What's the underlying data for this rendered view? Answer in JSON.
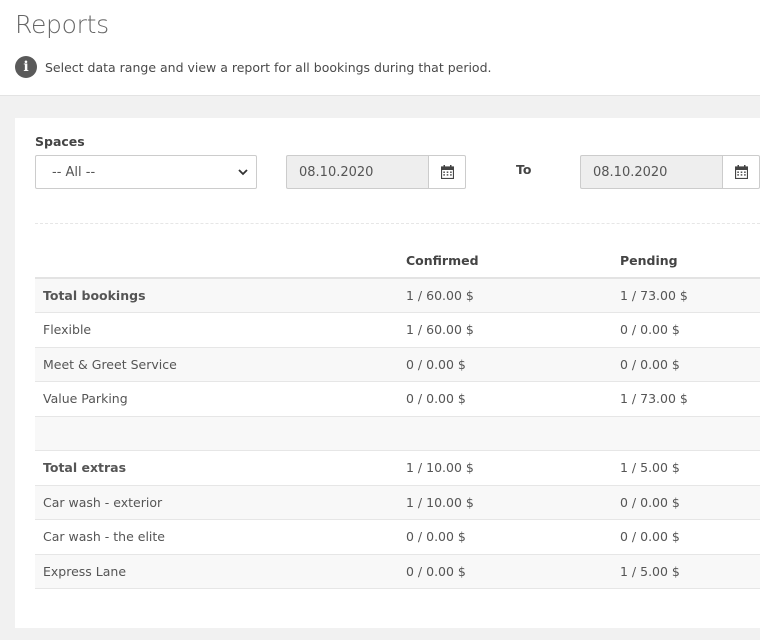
{
  "header": {
    "title": "Reports",
    "info_text": "Select data range and view a report for all bookings during that period."
  },
  "filters": {
    "spaces_label": "Spaces",
    "spaces_selected": "-- All --",
    "date_from": "08.10.2020",
    "to_label": "To",
    "date_to": "08.10.2020"
  },
  "table": {
    "columns": [
      "",
      "Confirmed",
      "Pending"
    ],
    "rows": [
      {
        "label": "Total bookings",
        "confirmed": "1 / 60.00 $",
        "pending": "1 / 73.00 $",
        "bold": true,
        "striped": true
      },
      {
        "label": "Flexible",
        "confirmed": "1 / 60.00 $",
        "pending": "0 / 0.00 $",
        "bold": false,
        "striped": false
      },
      {
        "label": "Meet & Greet Service",
        "confirmed": "0 / 0.00 $",
        "pending": "0 / 0.00 $",
        "bold": false,
        "striped": true
      },
      {
        "label": "Value Parking",
        "confirmed": "0 / 0.00 $",
        "pending": "1 / 73.00 $",
        "bold": false,
        "striped": false
      },
      {
        "label": "",
        "confirmed": "",
        "pending": "",
        "bold": false,
        "striped": true
      },
      {
        "label": "Total extras",
        "confirmed": "1 / 10.00 $",
        "pending": "1 / 5.00 $",
        "bold": true,
        "striped": false
      },
      {
        "label": "Car wash - exterior",
        "confirmed": "1 / 10.00 $",
        "pending": "0 / 0.00 $",
        "bold": false,
        "striped": true
      },
      {
        "label": "Car wash - the elite",
        "confirmed": "0 / 0.00 $",
        "pending": "0 / 0.00 $",
        "bold": false,
        "striped": false
      },
      {
        "label": "Express Lane",
        "confirmed": "0 / 0.00 $",
        "pending": "1 / 5.00 $",
        "bold": false,
        "striped": true
      }
    ]
  },
  "icons": {
    "info": "info-circle-icon",
    "calendar": "calendar-icon",
    "caret": "chevron-down-icon"
  }
}
